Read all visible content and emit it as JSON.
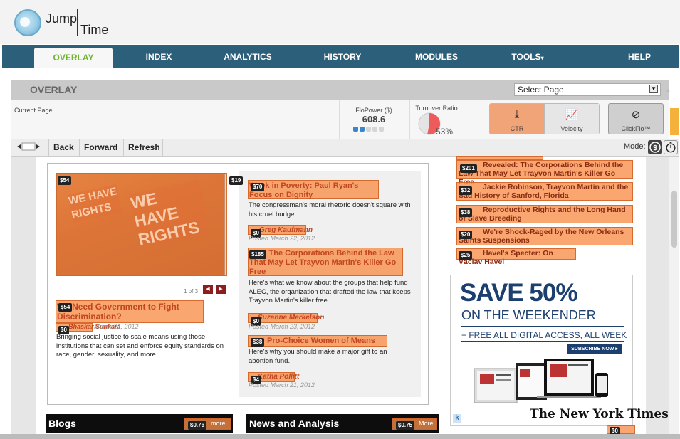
{
  "logo": {
    "word1": "Jump",
    "word2": "Time"
  },
  "nav": [
    {
      "label": "OVERLAY"
    },
    {
      "label": "INDEX"
    },
    {
      "label": "ANALYTICS"
    },
    {
      "label": "HISTORY"
    },
    {
      "label": "MODULES"
    },
    {
      "label": "TOOLS"
    },
    {
      "label": "HELP"
    }
  ],
  "overlay": {
    "title": "OVERLAY",
    "select_value": "Select Page"
  },
  "info": {
    "current_page_label": "Current Page",
    "flopower_label": "FloPower ($)",
    "flopower_value": "608.6",
    "flopower_level": 0.4,
    "turnover_label": "Turnover Ratio",
    "turnover_value": "53%",
    "turnover_fraction": 0.53
  },
  "metric_buttons": {
    "ctr": "CTR",
    "velocity": "Velocity",
    "clickflo": "ClickFlo™"
  },
  "toolbar": {
    "back": "Back",
    "forward": "Forward",
    "refresh": "Refresh",
    "mode_label": "Mode:"
  },
  "photo_signs": {
    "sign1": "WE HAVE RIGHTS",
    "sign2": "WE HAVE RIGHTS"
  },
  "prices": {
    "photo": "$54",
    "photo_right": "$19",
    "poverty": "$70",
    "poverty_author": "$0",
    "corporations": "$185",
    "left_story": "$54",
    "left_author": "$0",
    "merkelson": "$0",
    "prochoice": "$38",
    "pollitt": "$4",
    "blogs": "$0.76",
    "news": "$0.75",
    "bottom_right": "$0",
    "right1": "$201",
    "right2": "$32",
    "right3": "$38",
    "right4": "$20",
    "right5": "$25"
  },
  "stories": {
    "poverty_headline": "Week in Poverty: Paul Ryan's Focus on Dignity",
    "poverty_body": "The congressman's moral rhetoric doesn't square with his cruel budget.",
    "poverty_author": "Greg Kaufmann",
    "poverty_date": "Posted March 22, 2012",
    "corp_headline": "Bad: The Corporations Behind the Law That May Let Trayvon Martin's Killer Go Free",
    "corp_body": "Here's what we know about the groups that help fund ALEC, the organization that drafted the law that keeps Trayvon Martin's killer free.",
    "merkelson_author": "Suzanne Merkelson",
    "merkelson_date": "Posted March 23, 2012",
    "prochoice_headline": "Pro-Choice Women of Means",
    "prochoice_body": "Here's why you should make a major gift to an abortion fund.",
    "pollitt_author": "Katha Pollitt",
    "pollitt_date": "Posted March 21, 2012",
    "left_headline": "We Need Government to Fight Discrimination?",
    "left_author": "Bhaskar Sunkara",
    "left_date": "March 21, 2012",
    "left_body": "Bringing social justice to scale means using those institutions that can set and enforce equity standards on race, gender, sexuality, and more.",
    "slide_count": "1 of 3"
  },
  "right_list": [
    {
      "text": "Revealed: The Corporations Behind the Law That May Let Trayvon Martin's Killer Go Free"
    },
    {
      "text": "Jackie Robinson, Trayvon Martin and the Sad History of Sanford, Florida"
    },
    {
      "text": "Reproductive Rights and the Long Hand of Slave Breeding"
    },
    {
      "text": "We're Shock-Raged by the New Orleans Saints Suspensions"
    },
    {
      "text": "Havel's Specter: On Václav Havel"
    }
  ],
  "ad": {
    "headline": "SAVE 50%",
    "sub": "ON THE WEEKENDER",
    "free": "+ FREE ALL DIGITAL ACCESS, ALL WEEK",
    "subscribe": "SUBSCRIBE NOW ▸",
    "brand": "The New York Times",
    "k": "k"
  },
  "sections": {
    "blogs": "Blogs",
    "news": "News and Analysis",
    "more1": "more",
    "more2": "More"
  },
  "colors": {
    "nav": "#2b5f7a",
    "overlay": "#f78d48",
    "active_tab_text": "#6fb32f",
    "scroll_thumb": "#f4b23a"
  }
}
